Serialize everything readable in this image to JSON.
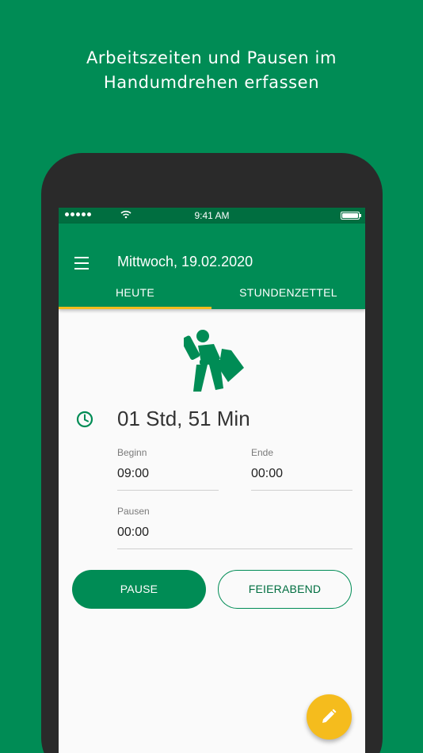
{
  "headline": {
    "line1": "Arbeitszeiten und Pausen im",
    "line2": "Handumdrehen erfassen"
  },
  "status_bar": {
    "time": "9:41 AM",
    "signal_icon": "signal-dots-icon",
    "wifi_icon": "wifi-icon",
    "battery_icon": "battery-icon"
  },
  "app_bar": {
    "menu_icon": "hamburger-menu-icon",
    "title": "Mittwoch, 19.02.2020"
  },
  "tabs": [
    {
      "label": "HEUTE",
      "active": true
    },
    {
      "label": "STUNDENZETTEL",
      "active": false
    }
  ],
  "status_figure": "person-reclining-icon",
  "duration": {
    "icon": "clock-icon",
    "text": "01 Std, 51 Min"
  },
  "fields": {
    "begin": {
      "label": "Beginn",
      "value": "09:00"
    },
    "end": {
      "label": "Ende",
      "value": "00:00"
    },
    "pauses": {
      "label": "Pausen",
      "value": "00:00"
    }
  },
  "buttons": {
    "pause": "PAUSE",
    "end_of_day": "FEIERABEND"
  },
  "fab": {
    "icon": "pencil-edit-icon"
  },
  "colors": {
    "primary": "#008c55",
    "primary_dark": "#006e40",
    "accent": "#f5bc1d",
    "tab_indicator": "#f2bb1d"
  }
}
